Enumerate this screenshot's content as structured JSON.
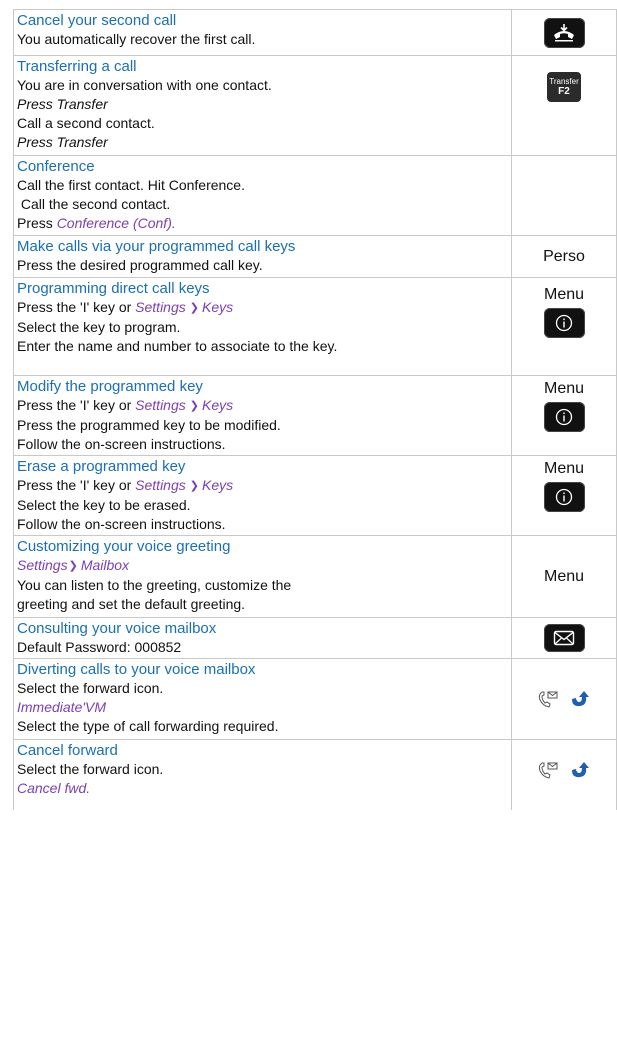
{
  "rows": [
    {
      "title": "Cancel your second call",
      "lines": [
        "You automatically recover the first call."
      ],
      "icon": "hang-up-key"
    },
    {
      "title": "Transferring a call",
      "lines": [
        "You are in conversation with one contact.",
        "Press Transfer",
        "Call a second contact.",
        "Press Transfer"
      ],
      "transfer_key": {
        "line1": "Transfer",
        "line2": "F2"
      }
    },
    {
      "title": "Conference",
      "lines": [
        "Call the first contact. Hit Conference.",
        " Call the second contact."
      ],
      "press_prefix": "Press ",
      "press_action": "Conference (Conf)."
    },
    {
      "title": "Make calls via your programmed call keys",
      "lines": [
        "Press the desired programmed call key."
      ],
      "side_label": "Perso"
    },
    {
      "title": "Programming direct call keys",
      "press_line": {
        "prefix": "Press the 'I' key or ",
        "path1": "Settings",
        "path2": "Keys"
      },
      "lines": [
        "Select the key to program.",
        "Enter the name and number to associate to the key."
      ],
      "side_label": "Menu"
    },
    {
      "title": "Modify the programmed key",
      "press_line": {
        "prefix": "Press the 'I' key or ",
        "path1": "Settings",
        "path2": "Keys"
      },
      "lines": [
        "Press the programmed key to be modified.",
        "Follow the on-screen instructions."
      ],
      "side_label": "Menu"
    },
    {
      "title": "Erase a programmed key",
      "press_line": {
        "prefix": "Press the 'I' key or ",
        "path1": "Settings",
        "path2": "Keys"
      },
      "lines": [
        "Select the key to be erased.",
        "Follow the on-screen instructions."
      ],
      "side_label": "Menu"
    },
    {
      "title": "Customizing your voice greeting",
      "path": {
        "path1": "Settings",
        "path2": "Mailbox"
      },
      "lines": [
        "You can listen to the greeting, customize the greeting and set the default greeting."
      ],
      "side_label": "Menu"
    },
    {
      "title": "Consulting your voice mailbox",
      "lines": [
        "Default Password: 000852"
      ],
      "icon": "mail-key"
    },
    {
      "title": "Diverting calls to your voice mailbox",
      "lines": [
        "Select the forward icon."
      ],
      "option": "Immediate'VM",
      "lines_after": [
        "Select the type of call forwarding required."
      ],
      "icon": "forward-icons"
    },
    {
      "title": "Cancel forward",
      "lines": [
        "Select the forward icon."
      ],
      "option": "Cancel fwd.",
      "icon": "forward-icons"
    }
  ],
  "chevron": "❯",
  "colors": {
    "title": "#1a6fb3",
    "action": "#7b3fb5",
    "forward_arrow": "#1f5fb0"
  }
}
